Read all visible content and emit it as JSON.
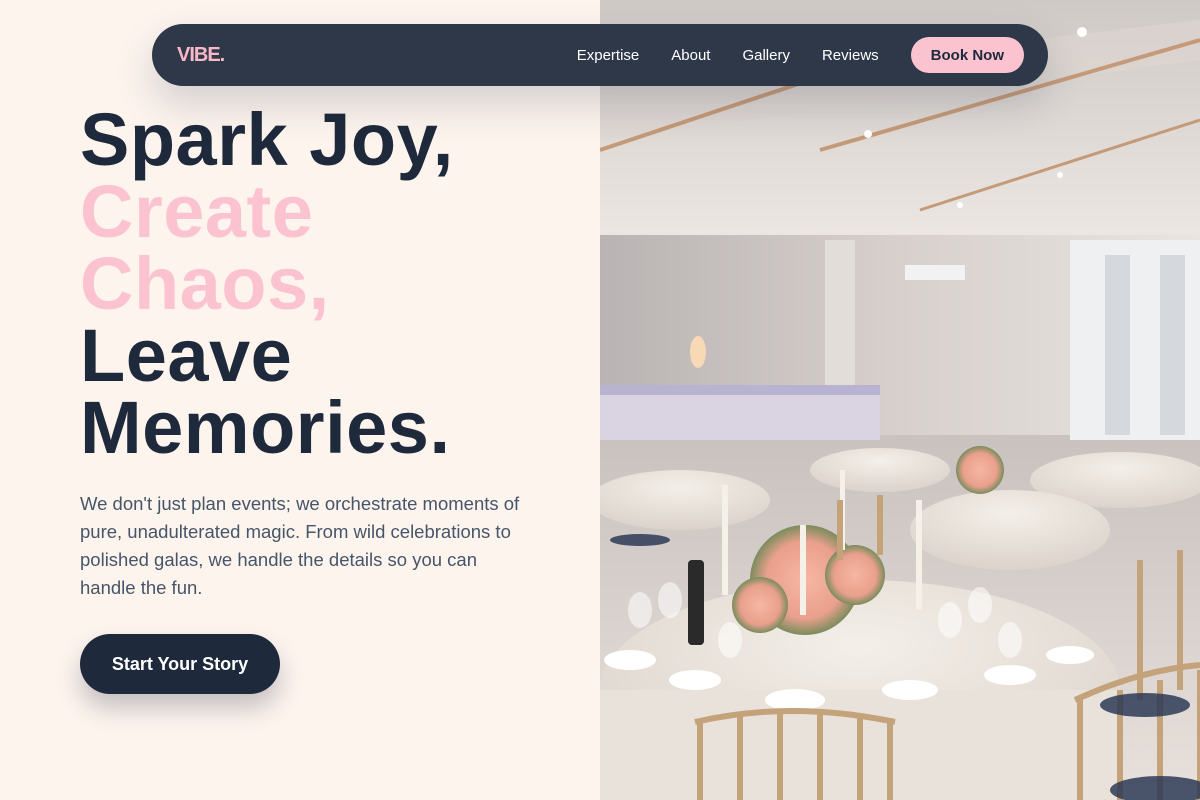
{
  "brand": {
    "logo": "VIBE."
  },
  "nav": {
    "links": [
      "Expertise",
      "About",
      "Gallery",
      "Reviews"
    ],
    "cta": "Book Now"
  },
  "hero": {
    "headline": {
      "line1": "Spark Joy,",
      "line2": "Create",
      "line3": "Chaos,",
      "line4": "Leave",
      "line5": "Memories."
    },
    "intro": "We don't just plan events; we orchestrate moments of pure, unadulterated magic. From wild celebrations to polished galas, we handle the details so you can handle the fun.",
    "cta": "Start Your Story",
    "image_subject": "wedding-reception-banquet-hall"
  },
  "colors": {
    "background": "#fdf4ee",
    "navbar": "#2f3849",
    "accent_pink": "#fbc3cf",
    "dark": "#1e293b",
    "body_text": "#475569"
  }
}
